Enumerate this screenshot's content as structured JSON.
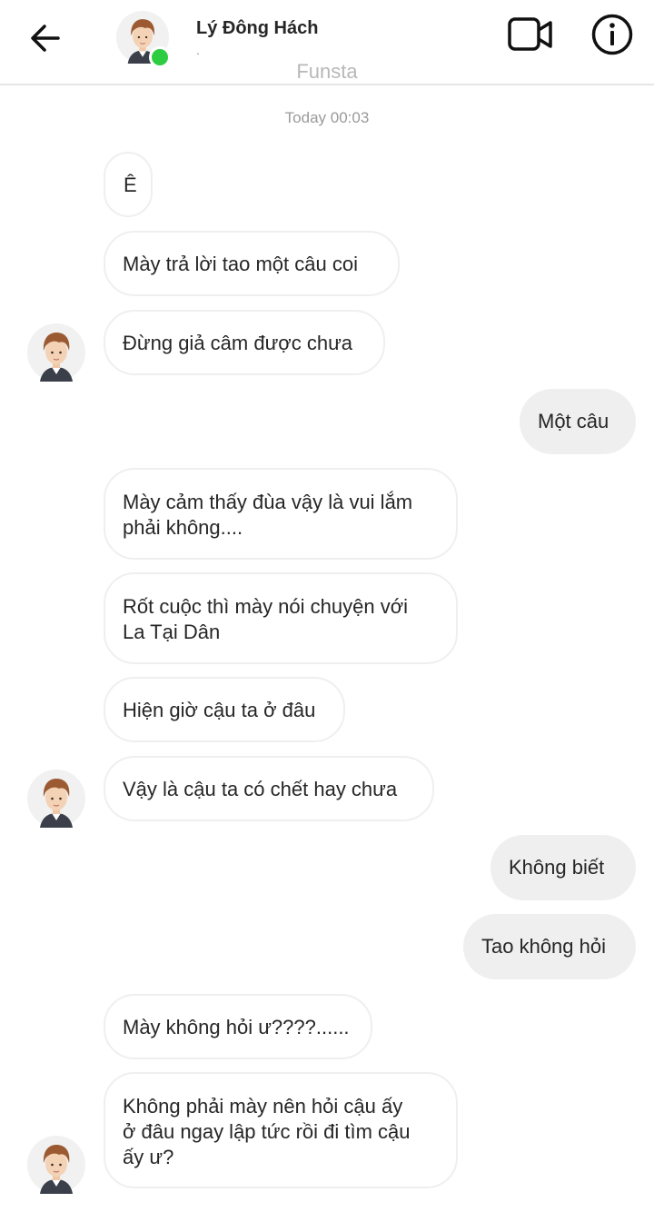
{
  "header": {
    "contact_name": "Lý Đông Hách",
    "contact_subtitle": ".",
    "app_label": "Funsta",
    "icons": [
      "back-arrow-icon",
      "video-call-icon",
      "info-icon"
    ],
    "online_status_color": "#2ecc40"
  },
  "chat": {
    "timestamp": "Today 00:03",
    "messages": [
      {
        "from": "them",
        "text": "Ê"
      },
      {
        "from": "them",
        "text": "Mày trả lời tao một câu coi"
      },
      {
        "from": "them",
        "text": "Đừng giả câm được chưa"
      },
      {
        "from": "me",
        "text": "Một câu"
      },
      {
        "from": "them",
        "text": "Mày cảm thấy đùa vậy là vui lắm\nphải không...."
      },
      {
        "from": "them",
        "text": "Rốt cuộc thì mày nói chuyện với\nLa Tại Dân"
      },
      {
        "from": "them",
        "text": "Hiện giờ cậu ta ở đâu"
      },
      {
        "from": "them",
        "text": "Vậy là cậu ta có chết hay chưa"
      },
      {
        "from": "me",
        "text": "Không biết"
      },
      {
        "from": "me",
        "text": "Tao không hỏi"
      },
      {
        "from": "them",
        "text": "Mày không hỏi ư????......"
      },
      {
        "from": "them",
        "text": "Không phải mày nên hỏi cậu ấy\nở đâu ngay lập tức rồi đi tìm cậu\nấy ư?"
      }
    ]
  },
  "colors": {
    "incoming_border": "#efefef",
    "outgoing_bg": "#efefef",
    "text": "#262626",
    "meta_text": "#9a9a9a"
  }
}
